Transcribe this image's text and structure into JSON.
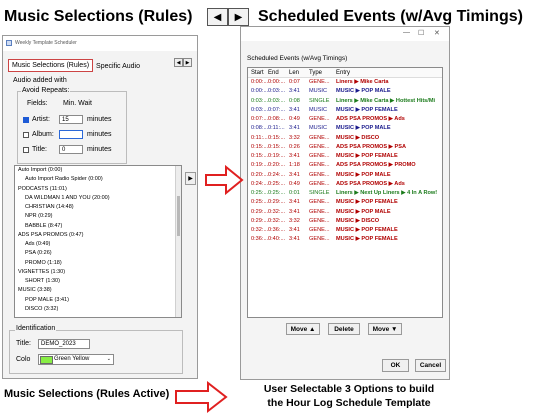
{
  "header": {
    "left_title": "Music Selections (Rules)",
    "right_title": "Scheduled Events (w/Avg Timings)",
    "arrow_left": "◀",
    "arrow_right": "▶"
  },
  "left_window": {
    "title": "Weekly Template Scheduler",
    "tabs": [
      {
        "label": "Music Selections (Rules)",
        "active": true
      },
      {
        "label": "Specific Audio",
        "active": false
      }
    ],
    "tab_arrow_left": "◀",
    "tab_arrow_right": "▶",
    "audio_added_with": "Audio added with",
    "avoid_repeats": "Avoid Repeats:",
    "fields_label": "Fields:",
    "min_wait_label": "Min. Wait",
    "fields": [
      {
        "label": "Artist:",
        "checked": true,
        "value": "15",
        "unit": "minutes"
      },
      {
        "label": "Album:",
        "checked": false,
        "value": "",
        "unit": "minutes"
      },
      {
        "label": "Title:",
        "checked": false,
        "value": "0",
        "unit": "minutes"
      }
    ],
    "side_button": "▶",
    "list_items": [
      {
        "text": "Auto Import (0:00)",
        "indent": 0
      },
      {
        "text": "Auto Import Radio Spider (0:00)",
        "indent": 1
      },
      {
        "text": "PODCASTS (11:01)",
        "indent": 0
      },
      {
        "text": "DA WILDMAN 1 AND YOU (20:00)",
        "indent": 1
      },
      {
        "text": "CHRISTIAN (14:48)",
        "indent": 1
      },
      {
        "text": "NPR (0:29)",
        "indent": 1
      },
      {
        "text": "BABBLE (8:47)",
        "indent": 1
      },
      {
        "text": "ADS PSA PROMOS (0:47)",
        "indent": 0
      },
      {
        "text": "Ads (0:49)",
        "indent": 1
      },
      {
        "text": "PSA (0:26)",
        "indent": 1
      },
      {
        "text": "PROMO (1:18)",
        "indent": 1
      },
      {
        "text": "VIGNETTES (1:30)",
        "indent": 0
      },
      {
        "text": "SHORT (1:30)",
        "indent": 1
      },
      {
        "text": "MUSIC (3:38)",
        "indent": 0
      },
      {
        "text": "POP MALE (3:41)",
        "indent": 1
      },
      {
        "text": "DISCO (3:32)",
        "indent": 1
      }
    ],
    "identification_label": "Identification",
    "title_label": "Title:",
    "title_value": "DEMO_2023",
    "color_label": "Colo",
    "color_value": "Green Yellow",
    "color_swatch": "#88ee44"
  },
  "right_window": {
    "title": "Scheduled Events (w/Avg Timings)",
    "columns": [
      "Start",
      "End",
      "Len",
      "Type",
      "Entry"
    ],
    "rows": [
      {
        "start": "0:00:...",
        "end": "0:00:...",
        "len": "0:07",
        "type": "GENE...",
        "entry": "Liners ▶ Mike Carta",
        "color": "#b00000"
      },
      {
        "start": "0:00:...",
        "end": "0:03:...",
        "len": "3:41",
        "type": "MUSIC",
        "entry": "MUSIC ▶ POP MALE",
        "color": "#1a1a8c"
      },
      {
        "start": "0:03:...",
        "end": "0:03:...",
        "len": "0:08",
        "type": "SINGLE",
        "entry": "Liners ▶ Mike Carta ▶ Hottest Hits/Mi",
        "color": "#1a7a1a"
      },
      {
        "start": "0:03:...",
        "end": "0:07:...",
        "len": "3:41",
        "type": "MUSIC",
        "entry": "MUSIC ▶ POP FEMALE",
        "color": "#1a1a8c"
      },
      {
        "start": "0:07:...",
        "end": "0:08:...",
        "len": "0:49",
        "type": "GENE...",
        "entry": "ADS PSA PROMOS ▶ Ads",
        "color": "#b00000"
      },
      {
        "start": "0:08:...",
        "end": "0:11:...",
        "len": "3:41",
        "type": "MUSIC",
        "entry": "MUSIC ▶ POP MALE",
        "color": "#1a1a8c"
      },
      {
        "start": "0:11:...",
        "end": "0:15:...",
        "len": "3:32",
        "type": "GENE...",
        "entry": "MUSIC ▶ DISCO",
        "color": "#b00000"
      },
      {
        "start": "0:15:...",
        "end": "0:15:...",
        "len": "0:26",
        "type": "GENE...",
        "entry": "ADS PSA PROMOS ▶ PSA",
        "color": "#b00000"
      },
      {
        "start": "0:15:...",
        "end": "0:19:...",
        "len": "3:41",
        "type": "GENE...",
        "entry": "MUSIC ▶ POP FEMALE",
        "color": "#b00000"
      },
      {
        "start": "0:19:...",
        "end": "0:20:...",
        "len": "1:18",
        "type": "GENE...",
        "entry": "ADS PSA PROMOS ▶ PROMO",
        "color": "#b00000"
      },
      {
        "start": "0:20:...",
        "end": "0:24:...",
        "len": "3:41",
        "type": "GENE...",
        "entry": "MUSIC ▶ POP MALE",
        "color": "#b00000"
      },
      {
        "start": "0:24:...",
        "end": "0:25:...",
        "len": "0:49",
        "type": "GENE...",
        "entry": "ADS PSA PROMOS ▶ Ads",
        "color": "#b00000"
      },
      {
        "start": "0:25:...",
        "end": "0:25:...",
        "len": "0:01",
        "type": "SINGLE",
        "entry": "Liners ▶ Next Up Liners ▶ 4 In A Row!",
        "color": "#1a7a1a"
      },
      {
        "start": "0:25:...",
        "end": "0:29:...",
        "len": "3:41",
        "type": "GENE...",
        "entry": "MUSIC ▶ POP FEMALE",
        "color": "#b00000"
      },
      {
        "start": "0:29:...",
        "end": "0:32:...",
        "len": "3:41",
        "type": "GENE...",
        "entry": "MUSIC ▶ POP MALE",
        "color": "#b00000"
      },
      {
        "start": "0:29:...",
        "end": "0:32:...",
        "len": "3:32",
        "type": "GENE...",
        "entry": "MUSIC ▶ DISCO",
        "color": "#b00000"
      },
      {
        "start": "0:32:...",
        "end": "0:36:...",
        "len": "3:41",
        "type": "GENE...",
        "entry": "MUSIC ▶ POP FEMALE",
        "color": "#b00000"
      },
      {
        "start": "0:36:...",
        "end": "0:40:...",
        "len": "3:41",
        "type": "GENE...",
        "entry": "MUSIC ▶ POP FEMALE",
        "color": "#b00000"
      }
    ],
    "move_up": "Move ▲",
    "delete": "Delete",
    "move_down": "Move ▼",
    "ok": "OK",
    "cancel": "Cancel",
    "win_controls": [
      "—",
      "☐",
      "✕"
    ]
  },
  "annotations": {
    "left_caption": "Music Selections (Rules Active)",
    "right_caption_line1": "User Selectable 3 Options to build",
    "right_caption_line2": "the Hour Log Schedule Template",
    "arrow_color": "#e02020"
  }
}
